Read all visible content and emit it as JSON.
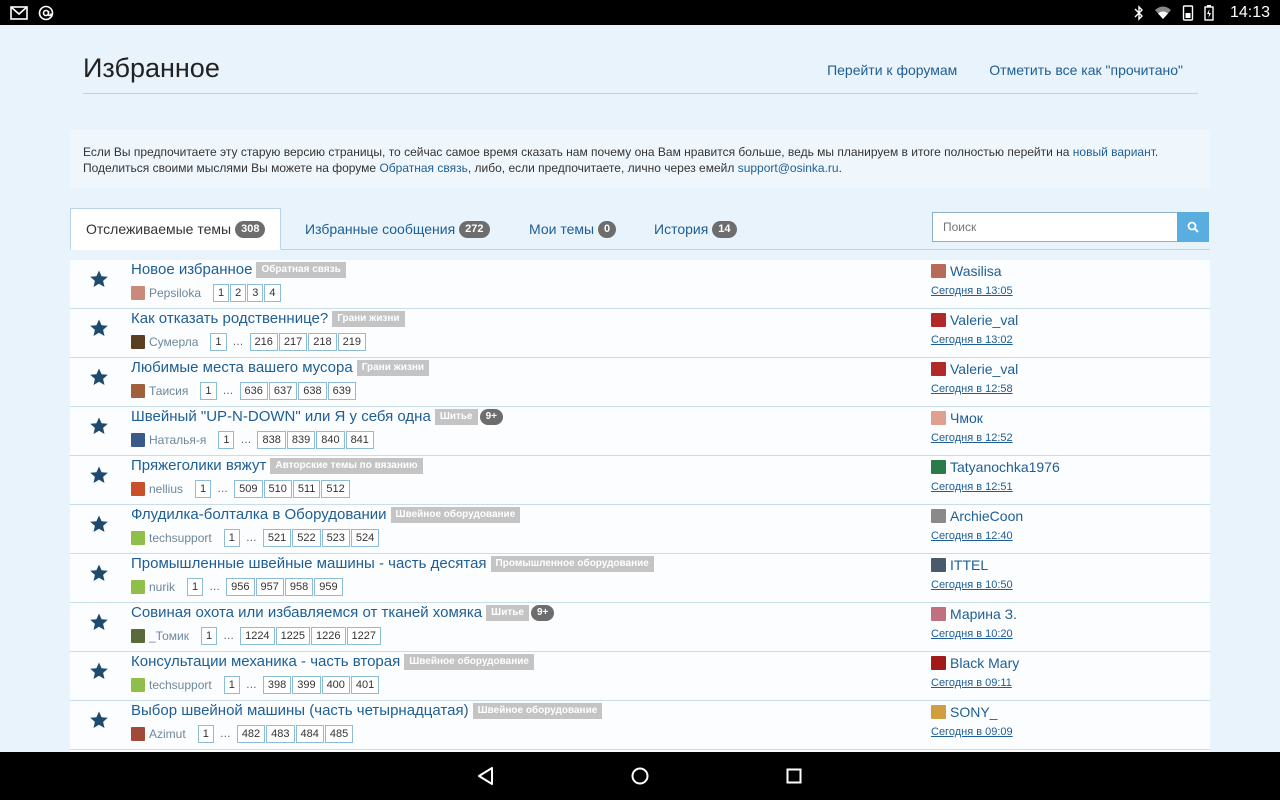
{
  "status_bar": {
    "time": "14:13",
    "left_icons": [
      "mail-icon",
      "at-icon"
    ],
    "right_icons": [
      "bluetooth-icon",
      "wifi-icon",
      "phone-icon",
      "battery-icon"
    ]
  },
  "header": {
    "title": "Избранное",
    "links": [
      "Перейти к форумам",
      "Отметить все как \"прочитано\""
    ]
  },
  "notice": {
    "text1": "Если Вы предпочитаете эту старую версию страницы, то сейчас самое время сказать нам почему она Вам нравится больше, ведь мы планируем в итоге полностью перейти на ",
    "link1": "новый вариант",
    "text2": ".",
    "text3": "Поделиться своими мыслями Вы можете на форуме ",
    "link2": "Обратная связь",
    "text4": ", либо, если предпочитаете, лично через емейл ",
    "link3": "support@osinka.ru",
    "text5": "."
  },
  "tabs": [
    {
      "label": "Отслеживаемые темы",
      "count": "308"
    },
    {
      "label": "Избранные сообщения",
      "count": "272"
    },
    {
      "label": "Мои темы",
      "count": "0"
    },
    {
      "label": "История",
      "count": "14"
    }
  ],
  "search": {
    "placeholder": "Поиск"
  },
  "colors": {
    "link": "#1f5e94",
    "badge": "#6d6d6d",
    "tag": "#c4c4c4",
    "search_button": "#5aaedf"
  },
  "topics": [
    {
      "title": "Новое избранное",
      "forum": "Обратная связь",
      "new": "",
      "author": "Pepsiloka",
      "first": "",
      "pages": [
        "1",
        "2",
        "3",
        "4"
      ],
      "last_user": "Wasilisa",
      "last_time": "Сегодня в 13:05",
      "av": "#c98a7a",
      "last_av": "#b86a5a"
    },
    {
      "title": "Как отказать родственнице?",
      "forum": "Грани жизни",
      "new": "",
      "author": "Сумерла",
      "first": "1",
      "pages": [
        "216",
        "217",
        "218",
        "219"
      ],
      "last_user": "Valerie_val",
      "last_time": "Сегодня в 13:02",
      "av": "#5a4020",
      "last_av": "#b02a2a"
    },
    {
      "title": "Любимые места вашего мусора",
      "forum": "Грани жизни",
      "new": "",
      "author": "Таисия",
      "first": "1",
      "pages": [
        "636",
        "637",
        "638",
        "639"
      ],
      "last_user": "Valerie_val",
      "last_time": "Сегодня в 12:58",
      "av": "#a0603a",
      "last_av": "#b02a2a"
    },
    {
      "title": "Швейный \"UP-N-DOWN\" или Я у себя одна",
      "forum": "Шитье",
      "new": "9+",
      "author": "Наталья-я",
      "first": "1",
      "pages": [
        "838",
        "839",
        "840",
        "841"
      ],
      "last_user": "Чмок",
      "last_time": "Сегодня в 12:52",
      "av": "#3a5a8a",
      "last_av": "#e0a090"
    },
    {
      "title": "Пряжеголики вяжут",
      "forum": "Авторские темы по вязанию",
      "new": "",
      "author": "nellius",
      "first": "1",
      "pages": [
        "509",
        "510",
        "511",
        "512"
      ],
      "last_user": "Tatyanochka1976",
      "last_time": "Сегодня в 12:51",
      "av": "#c8502a",
      "last_av": "#2a7a4a"
    },
    {
      "title": "Флудилка-болталка в Оборудовании",
      "forum": "Швейное оборудование",
      "new": "",
      "author": "techsupport",
      "first": "1",
      "pages": [
        "521",
        "522",
        "523",
        "524"
      ],
      "last_user": "ArchieCoon",
      "last_time": "Сегодня в 12:40",
      "av": "#8fbf4a",
      "last_av": "#8a8a8a"
    },
    {
      "title": "Промышленные швейные машины - часть десятая",
      "forum": "Промышленное оборудование",
      "new": "",
      "author": "nurik",
      "first": "1",
      "pages": [
        "956",
        "957",
        "958",
        "959"
      ],
      "last_user": "ITTEL",
      "last_time": "Сегодня в 10:50",
      "av": "#8fbf4a",
      "last_av": "#4a5a6a"
    },
    {
      "title": "Совиная охота или избавляемся от тканей хомяка",
      "forum": "Шитье",
      "new": "9+",
      "author": "_Томик",
      "first": "1",
      "pages": [
        "1224",
        "1225",
        "1226",
        "1227"
      ],
      "last_user": "Марина З.",
      "last_time": "Сегодня в 10:20",
      "av": "#5a6a3a",
      "last_av": "#c07080"
    },
    {
      "title": "Консультации механика - часть вторая",
      "forum": "Швейное оборудование",
      "new": "",
      "author": "techsupport",
      "first": "1",
      "pages": [
        "398",
        "399",
        "400",
        "401"
      ],
      "last_user": "Black Mary",
      "last_time": "Сегодня в 09:11",
      "av": "#8fbf4a",
      "last_av": "#a01a1a"
    },
    {
      "title": "Выбор швейной машины (часть четырнадцатая)",
      "forum": "Швейное оборудование",
      "new": "",
      "author": "Azimut",
      "first": "1",
      "pages": [
        "482",
        "483",
        "484",
        "485"
      ],
      "last_user": "SONY_",
      "last_time": "Сегодня в 09:09",
      "av": "#a04a3a",
      "last_av": "#d0a040"
    }
  ]
}
